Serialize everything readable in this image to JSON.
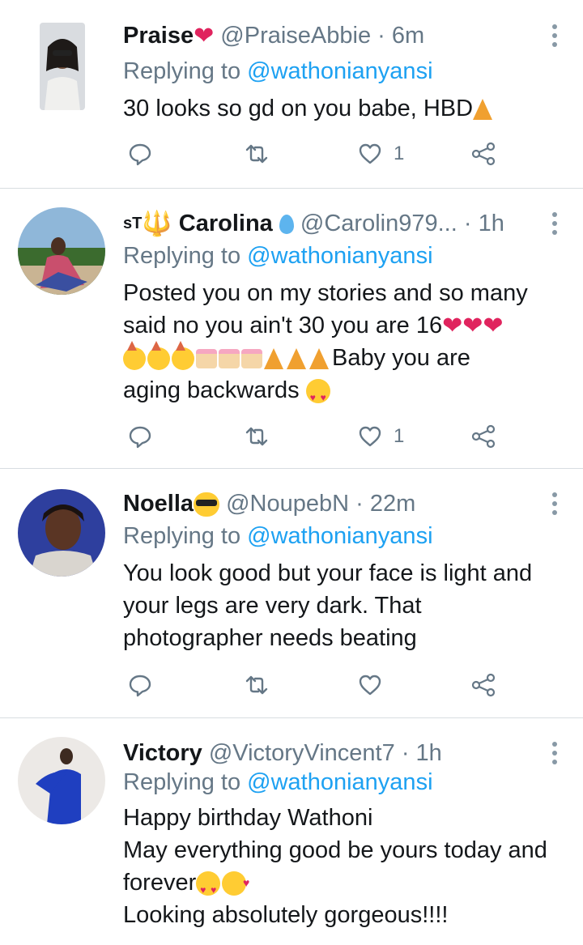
{
  "tweets": [
    {
      "name": "Praise",
      "handle": "@PraiseAbbie",
      "time": "· 6m",
      "reply_prefix": "Replying to",
      "reply_to": "@wathonianyansi",
      "lines": [
        "30 looks so gd on you babe, HBD"
      ],
      "likes": "1"
    },
    {
      "name_prefix": "sT",
      "name": "Carolina",
      "handle": "@Carolin979...",
      "time": "· 1h",
      "reply_prefix": "Replying to",
      "reply_to": "@wathonianyansi",
      "lines": [
        "Posted you on my stories and so many",
        "said no you ain't 30 you are 16",
        "Baby you are",
        "aging backwards"
      ],
      "likes": "1"
    },
    {
      "name": "Noella",
      "handle": "@NoupebN",
      "time": "· 22m",
      "reply_prefix": "Replying to",
      "reply_to": "@wathonianyansi",
      "lines": [
        "You look good but your face is light and",
        "your legs are very dark. That",
        "photographer needs beating"
      ],
      "likes": ""
    },
    {
      "name": "Victory",
      "handle": "@VictoryVincent7",
      "time": "· 1h",
      "reply_prefix": "Replying to",
      "reply_to": "@wathonianyansi",
      "lines": [
        "Happy birthday Wathoni",
        "May everything good be yours today and",
        "forever",
        "Looking absolutely gorgeous!!!!"
      ]
    }
  ],
  "icons": [
    "reply-icon",
    "retweet-icon",
    "like-icon",
    "share-icon",
    "more-icon"
  ],
  "colors": {
    "name": "#14171a",
    "meta": "#657786",
    "mention": "#1da1f2",
    "divider": "#d8dde1"
  }
}
